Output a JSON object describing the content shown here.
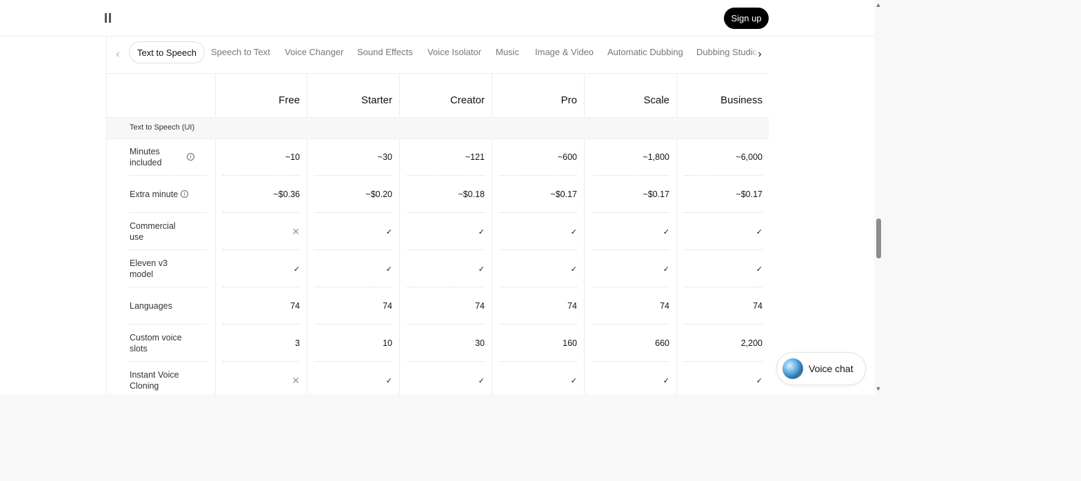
{
  "header": {
    "logo_icon": "pause-bars-logo",
    "signup_label": "Sign up"
  },
  "tabs": {
    "items": [
      {
        "label": "Text to Speech",
        "active": true
      },
      {
        "label": "Speech to Text"
      },
      {
        "label": "Voice Changer"
      },
      {
        "label": "Sound Effects"
      },
      {
        "label": "Voice Isolator"
      },
      {
        "label": "Music"
      },
      {
        "label": "Image & Video"
      },
      {
        "label": "Automatic Dubbing"
      },
      {
        "label": "Dubbing Studio"
      }
    ],
    "prev_icon": "chevron-left-icon",
    "next_icon": "chevron-right-icon"
  },
  "table": {
    "plans": [
      "Free",
      "Starter",
      "Creator",
      "Pro",
      "Scale",
      "Business"
    ],
    "section_title": "Text to Speech (UI)",
    "rows": [
      {
        "label": "Minutes included",
        "info": true,
        "values": [
          "~10",
          "~30",
          "~121",
          "~600",
          "~1,800",
          "~6,000"
        ]
      },
      {
        "label": "Extra minute",
        "info": true,
        "values": [
          "~$0.36",
          "~$0.20",
          "~$0.18",
          "~$0.17",
          "~$0.17",
          "~$0.17"
        ]
      },
      {
        "label": "Commercial use",
        "values": [
          "✕",
          "✓",
          "✓",
          "✓",
          "✓",
          "✓"
        ]
      },
      {
        "label": "Eleven v3 model",
        "values": [
          "✓",
          "✓",
          "✓",
          "✓",
          "✓",
          "✓"
        ]
      },
      {
        "label": "Languages",
        "values": [
          "74",
          "74",
          "74",
          "74",
          "74",
          "74"
        ]
      },
      {
        "label": "Custom voice slots",
        "values": [
          "3",
          "10",
          "30",
          "160",
          "660",
          "2,200"
        ]
      },
      {
        "label": "Instant Voice Cloning",
        "values": [
          "✕",
          "✓",
          "✓",
          "✓",
          "✓",
          "✓"
        ]
      }
    ]
  },
  "voice_chat": {
    "label": "Voice chat",
    "icon": "voice-orb-icon"
  },
  "scrollbar": {
    "up_icon": "scroll-up-arrow",
    "down_icon": "scroll-down-arrow"
  }
}
